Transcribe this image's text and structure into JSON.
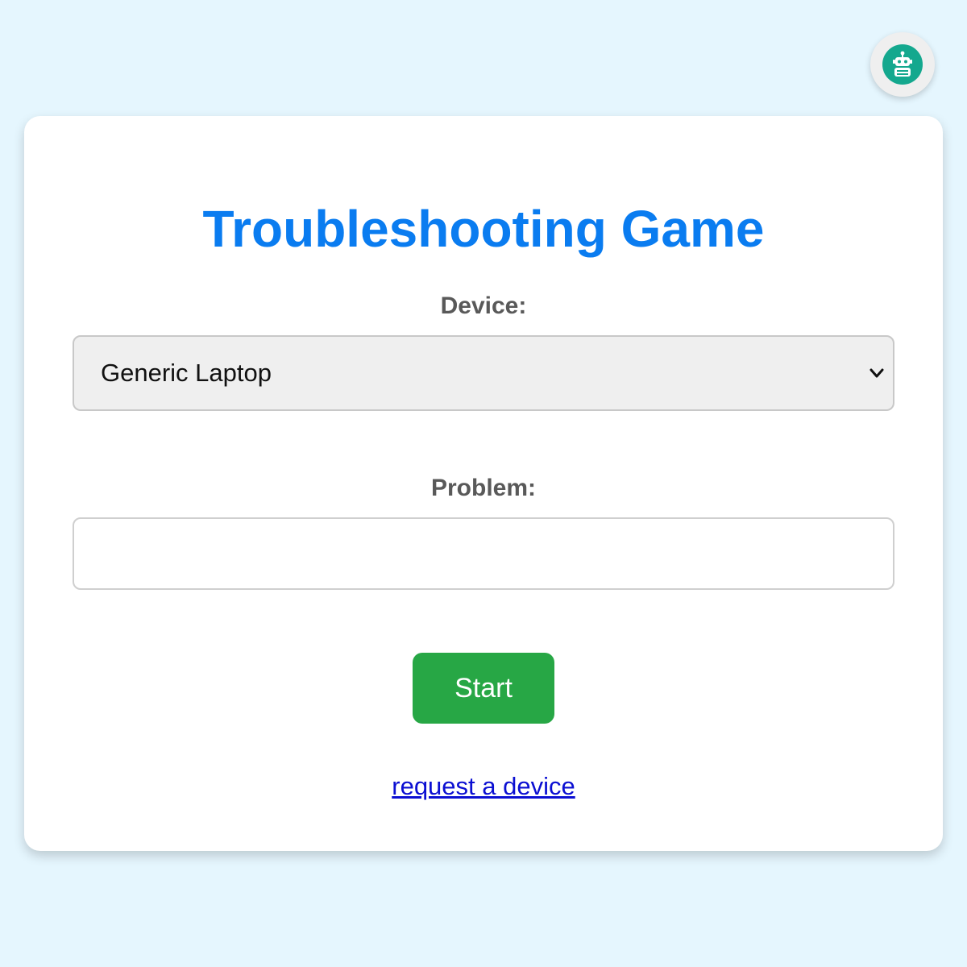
{
  "assistant": {
    "icon": "robot-icon",
    "accent_color": "#14a88e"
  },
  "form": {
    "title": "Troubleshooting Game",
    "device_label": "Device:",
    "device_selected": "Generic Laptop",
    "problem_label": "Problem:",
    "problem_value": "",
    "start_label": "Start",
    "request_link_text": "request a device"
  },
  "colors": {
    "background": "#e5f6fe",
    "title": "#0a7cf0",
    "start_button": "#27a745",
    "link": "#0b0fd2"
  }
}
